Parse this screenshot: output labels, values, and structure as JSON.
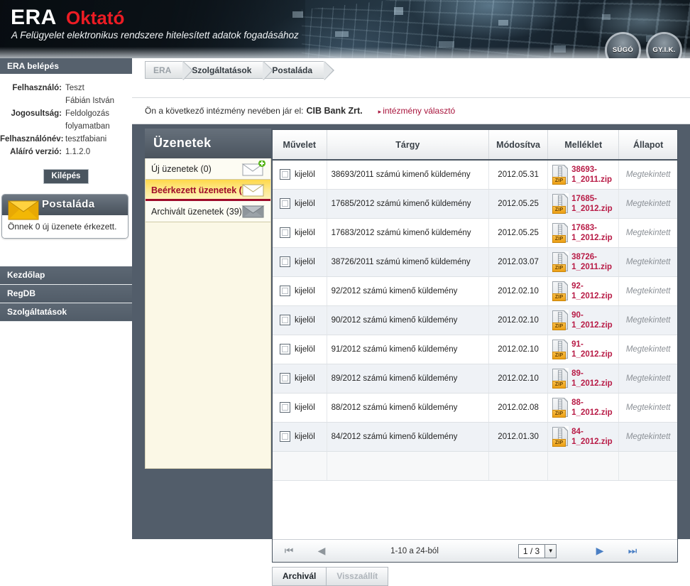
{
  "header": {
    "logo": "ERA",
    "logo_accent": "Oktató",
    "tagline": "A Felügyelet elektronikus rendszere hitelesített adatok fogadásához",
    "help_button": "SÚGÓ",
    "faq_button": "GY.I.K."
  },
  "sidebar": {
    "login_title": "ERA belépés",
    "fields": [
      {
        "label": "Felhasználó:",
        "value": "Teszt",
        "value2": "Fábián István"
      },
      {
        "label": "Jogosultság:",
        "value": "Feldolgozás",
        "value2": "folyamatban"
      },
      {
        "label": "Felhasználónév:",
        "value": "tesztfabiani",
        "value2": ""
      },
      {
        "label": "Aláíró verzió:",
        "value": "1.1.2.0",
        "value2": ""
      }
    ],
    "logout_label": "Kilépés",
    "mailbox": {
      "title": "Postaláda",
      "message": "Önnek 0 új üzenete érkezett.",
      "icon": "envelope-icon"
    },
    "nav": [
      {
        "label": "Kezdőlap"
      },
      {
        "label": "RegDB"
      },
      {
        "label": "Szolgáltatások"
      }
    ]
  },
  "breadcrumb": [
    {
      "label": "ERA",
      "active": false
    },
    {
      "label": "Szolgáltatások",
      "active": true
    },
    {
      "label": "Postaláda",
      "active": true
    }
  ],
  "institution": {
    "prefix": "Ön a következő intézmény nevében jár el:",
    "name": "CIB Bank Zrt.",
    "link": "intézmény választó",
    "link_color": "#a8143c"
  },
  "messages_panel": {
    "title": "Üzenetek",
    "items": [
      {
        "label": "Új üzenetek (0)",
        "selected": false,
        "icon": "new-mail-icon"
      },
      {
        "label": "Beérkezett üzenetek (24)",
        "selected": true,
        "icon": "open-mail-icon"
      },
      {
        "label": "Archivált üzenetek (39)",
        "selected": false,
        "icon": "archived-mail-icon"
      }
    ]
  },
  "table": {
    "columns": [
      "Művelet",
      "Tárgy",
      "Módosítva",
      "Melléklet",
      "Állapot"
    ],
    "select_label": "kijelöl",
    "rows": [
      {
        "subject": "38693/2011 számú kimenő küldemény",
        "modified": "2012.05.31",
        "attachment": "38693-1_2011.zip",
        "status": "Megtekintett"
      },
      {
        "subject": "17685/2012 számú kimenő küldemény",
        "modified": "2012.05.25",
        "attachment": "17685-1_2012.zip",
        "status": "Megtekintett"
      },
      {
        "subject": "17683/2012 számú kimenő küldemény",
        "modified": "2012.05.25",
        "attachment": "17683-1_2012.zip",
        "status": "Megtekintett"
      },
      {
        "subject": "38726/2011 számú kimenő küldemény",
        "modified": "2012.03.07",
        "attachment": "38726-1_2011.zip",
        "status": "Megtekintett"
      },
      {
        "subject": "92/2012 számú kimenő küldemény",
        "modified": "2012.02.10",
        "attachment": "92-1_2012.zip",
        "status": "Megtekintett"
      },
      {
        "subject": "90/2012 számú kimenő küldemény",
        "modified": "2012.02.10",
        "attachment": "90-1_2012.zip",
        "status": "Megtekintett"
      },
      {
        "subject": "91/2012 számú kimenő küldemény",
        "modified": "2012.02.10",
        "attachment": "91-1_2012.zip",
        "status": "Megtekintett"
      },
      {
        "subject": "89/2012 számú kimenő küldemény",
        "modified": "2012.02.10",
        "attachment": "89-1_2012.zip",
        "status": "Megtekintett"
      },
      {
        "subject": "88/2012 számú kimenő küldemény",
        "modified": "2012.02.08",
        "attachment": "88-1_2012.zip",
        "status": "Megtekintett"
      },
      {
        "subject": "84/2012 számú kimenő küldemény",
        "modified": "2012.01.30",
        "attachment": "84-1_2012.zip",
        "status": "Megtekintett"
      }
    ]
  },
  "pager": {
    "first": "⏮",
    "prev": "◀",
    "info": "1-10 a 24-ból",
    "page_value": "1 / 3",
    "next": "▶",
    "last": "⏭"
  },
  "actions": {
    "archive": "Archivál",
    "restore": "Visszaállít"
  }
}
